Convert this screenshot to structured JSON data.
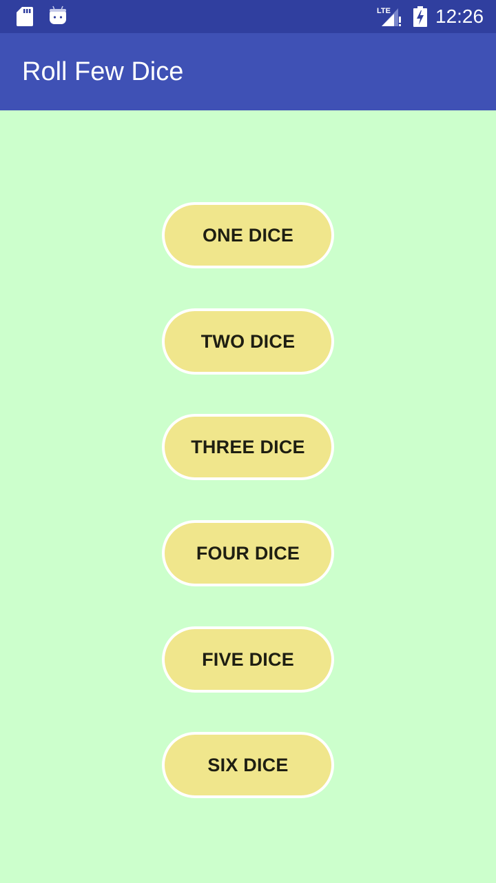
{
  "status_bar": {
    "left_icons": [
      "sd-card-icon",
      "android-debug-icon"
    ],
    "right_icons": [
      "lte-signal-icon",
      "battery-charging-icon"
    ],
    "network_label": "LTE",
    "time": "12:26"
  },
  "app_bar": {
    "title": "Roll Few Dice"
  },
  "buttons": [
    {
      "label": "ONE DICE"
    },
    {
      "label": "TWO DICE"
    },
    {
      "label": "THREE DICE"
    },
    {
      "label": "FOUR DICE"
    },
    {
      "label": "FIVE DICE"
    },
    {
      "label": "SIX DICE"
    }
  ],
  "colors": {
    "status_bar": "#303f9f",
    "app_bar": "#3f51b5",
    "background": "#ccffcc",
    "button_fill": "#f0e68c",
    "button_border": "#ffffff",
    "button_text": "#1e1e12"
  }
}
